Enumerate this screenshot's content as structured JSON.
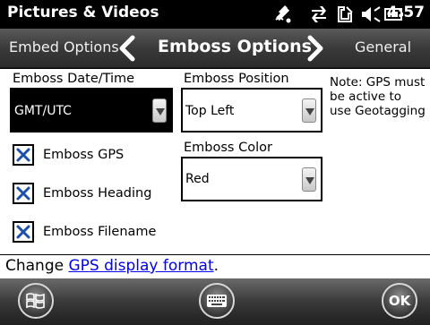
{
  "titlebar": {
    "app_title": "Pictures & Videos",
    "time": "4:57",
    "status_icons": [
      "bluetooth-icon",
      "sync-arrows-icon",
      "signal-icon",
      "volume-icon",
      "battery-icon"
    ]
  },
  "tabs": {
    "previous": "Embed Options",
    "current": "Emboss Options",
    "next": "General"
  },
  "form": {
    "date_label": "Emboss Date/Time",
    "date_value": "GMT/UTC",
    "position_label": "Emboss Position",
    "position_value": "Top Left",
    "color_label": "Emboss Color",
    "color_value": "Red",
    "note": "Note: GPS must be active to use Geotagging",
    "checkboxes": [
      {
        "label": "Emboss GPS",
        "checked": true
      },
      {
        "label": "Emboss Heading",
        "checked": true
      },
      {
        "label": "Emboss Filename",
        "checked": true
      }
    ]
  },
  "footer": {
    "change_prefix": "Change ",
    "change_link": "GPS display format",
    "change_suffix": "."
  },
  "softkeys": {
    "ok_label": "OK"
  },
  "colors": {
    "link": "#0000ee",
    "header_bg": "#3a3a3a",
    "selected_combo": "#000000"
  }
}
